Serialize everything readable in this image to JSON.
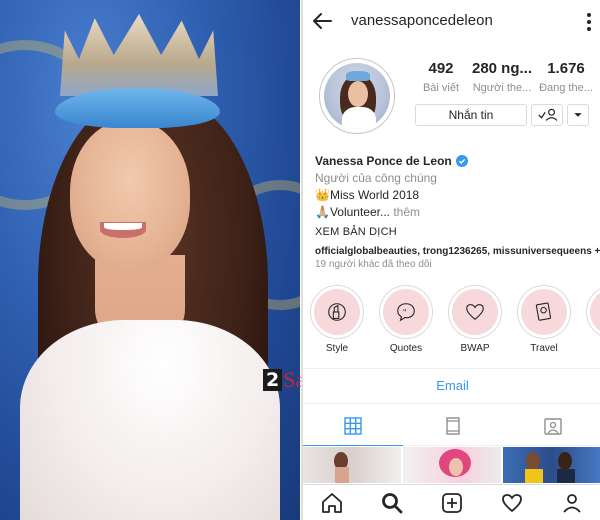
{
  "profile": {
    "username": "vanessaponcedeleon",
    "stats": [
      {
        "value": "492",
        "label": "Bài viết"
      },
      {
        "value": "280 ng...",
        "label": "Người the..."
      },
      {
        "value": "1.676",
        "label": "Đang the..."
      }
    ],
    "message_button": "Nhắn tin"
  },
  "bio": {
    "name": "Vanessa Ponce de Leon",
    "category": "Người của công chúng",
    "line1": "👑Miss World 2018",
    "line2": "🙏🏼Volunteer...",
    "more": " thêm",
    "translate": "XEM BẢN DỊCH",
    "followed_by": "officialglobalbeauties, trong1236265, missuniversequeens +",
    "followed_by_2": "19 người khác đã theo dõi"
  },
  "highlights": [
    {
      "label": "Style",
      "icon": "lipstick-icon"
    },
    {
      "label": "Quotes",
      "icon": "quote-bubble-icon"
    },
    {
      "label": "BWAP",
      "icon": "heart-icon"
    },
    {
      "label": "Travel",
      "icon": "passport-icon"
    }
  ],
  "contact": {
    "email_label": "Email"
  },
  "watermark": {
    "num": "2",
    "text": "Sao"
  },
  "colors": {
    "accent": "#3897f0",
    "highlight_bg": "#f7d8db",
    "watermark_red": "#d2232a"
  }
}
